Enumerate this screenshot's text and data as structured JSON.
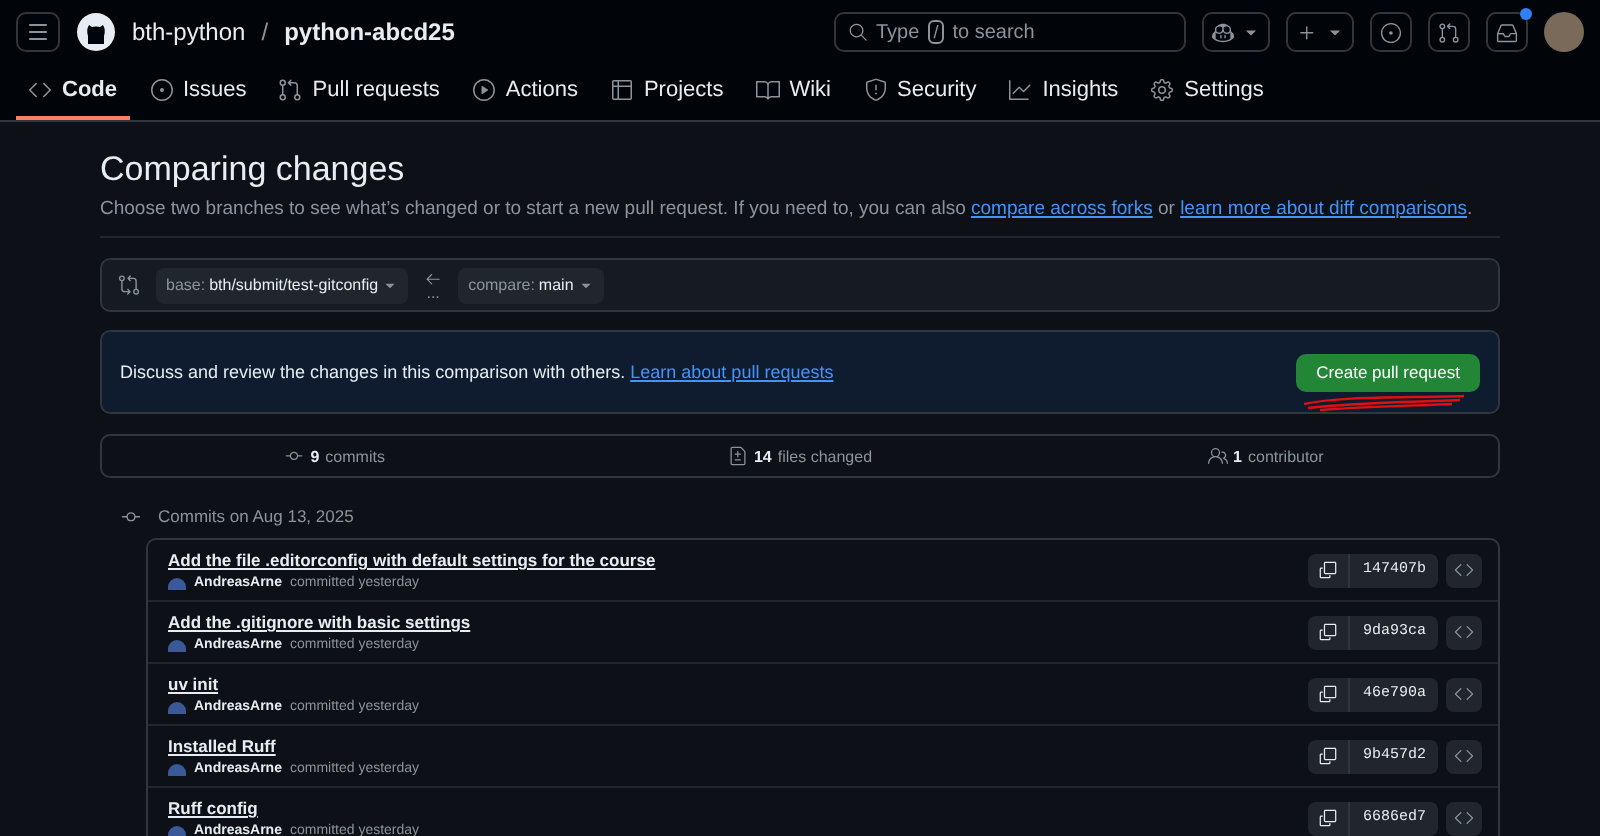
{
  "header": {
    "owner": "bth-python",
    "separator": "/",
    "repo": "python-abcd25",
    "search": {
      "before": "Type",
      "key": "/",
      "after": "to search"
    },
    "inbox_unread": true
  },
  "tabs": [
    {
      "kind": "code",
      "label": "Code",
      "selected": true
    },
    {
      "kind": "issues",
      "label": "Issues",
      "selected": false
    },
    {
      "kind": "pulls",
      "label": "Pull requests",
      "selected": false
    },
    {
      "kind": "actions",
      "label": "Actions",
      "selected": false
    },
    {
      "kind": "projects",
      "label": "Projects",
      "selected": false
    },
    {
      "kind": "wiki",
      "label": "Wiki",
      "selected": false
    },
    {
      "kind": "security",
      "label": "Security",
      "selected": false
    },
    {
      "kind": "insights",
      "label": "Insights",
      "selected": false
    },
    {
      "kind": "settings",
      "label": "Settings",
      "selected": false
    }
  ],
  "title": "Comparing changes",
  "description": [
    {
      "kind": "text",
      "text": "Choose two branches to see what’s changed or to start a new pull request. If you need to, you can also "
    },
    {
      "kind": "link",
      "text": "compare across forks"
    },
    {
      "kind": "text",
      "text": " or "
    },
    {
      "kind": "link",
      "text": "learn more about diff comparisons"
    },
    {
      "kind": "text",
      "text": "."
    }
  ],
  "range": {
    "base": {
      "prefix": "base:",
      "value": "bth/submit/test-gitconfig"
    },
    "dots": "...",
    "compare": {
      "prefix": "compare:",
      "value": "main"
    }
  },
  "banner": {
    "text": "Discuss and review the changes in this comparison with others.",
    "link": "Learn about pull requests",
    "button": "Create pull request"
  },
  "stats": [
    {
      "kind": "commits",
      "count": "9",
      "label": "commits"
    },
    {
      "kind": "files",
      "count": "14",
      "label": "files changed"
    },
    {
      "kind": "contributors",
      "count": "1",
      "label": "contributor"
    }
  ],
  "commit_group": {
    "heading": "Commits on Aug 13, 2025",
    "commits": [
      {
        "title": "Add the file .editorconfig with default settings for the course",
        "author": "AndreasArne",
        "meta": "committed yesterday",
        "sha": "147407b"
      },
      {
        "title": "Add the .gitignore with basic settings",
        "author": "AndreasArne",
        "meta": "committed yesterday",
        "sha": "9da93ca"
      },
      {
        "title": "uv init",
        "author": "AndreasArne",
        "meta": "committed yesterday",
        "sha": "46e790a"
      },
      {
        "title": "Installed Ruff",
        "author": "AndreasArne",
        "meta": "committed yesterday",
        "sha": "9b457d2"
      },
      {
        "title": "Ruff config",
        "author": "AndreasArne",
        "meta": "committed yesterday",
        "sha": "6686ed7"
      }
    ]
  }
}
